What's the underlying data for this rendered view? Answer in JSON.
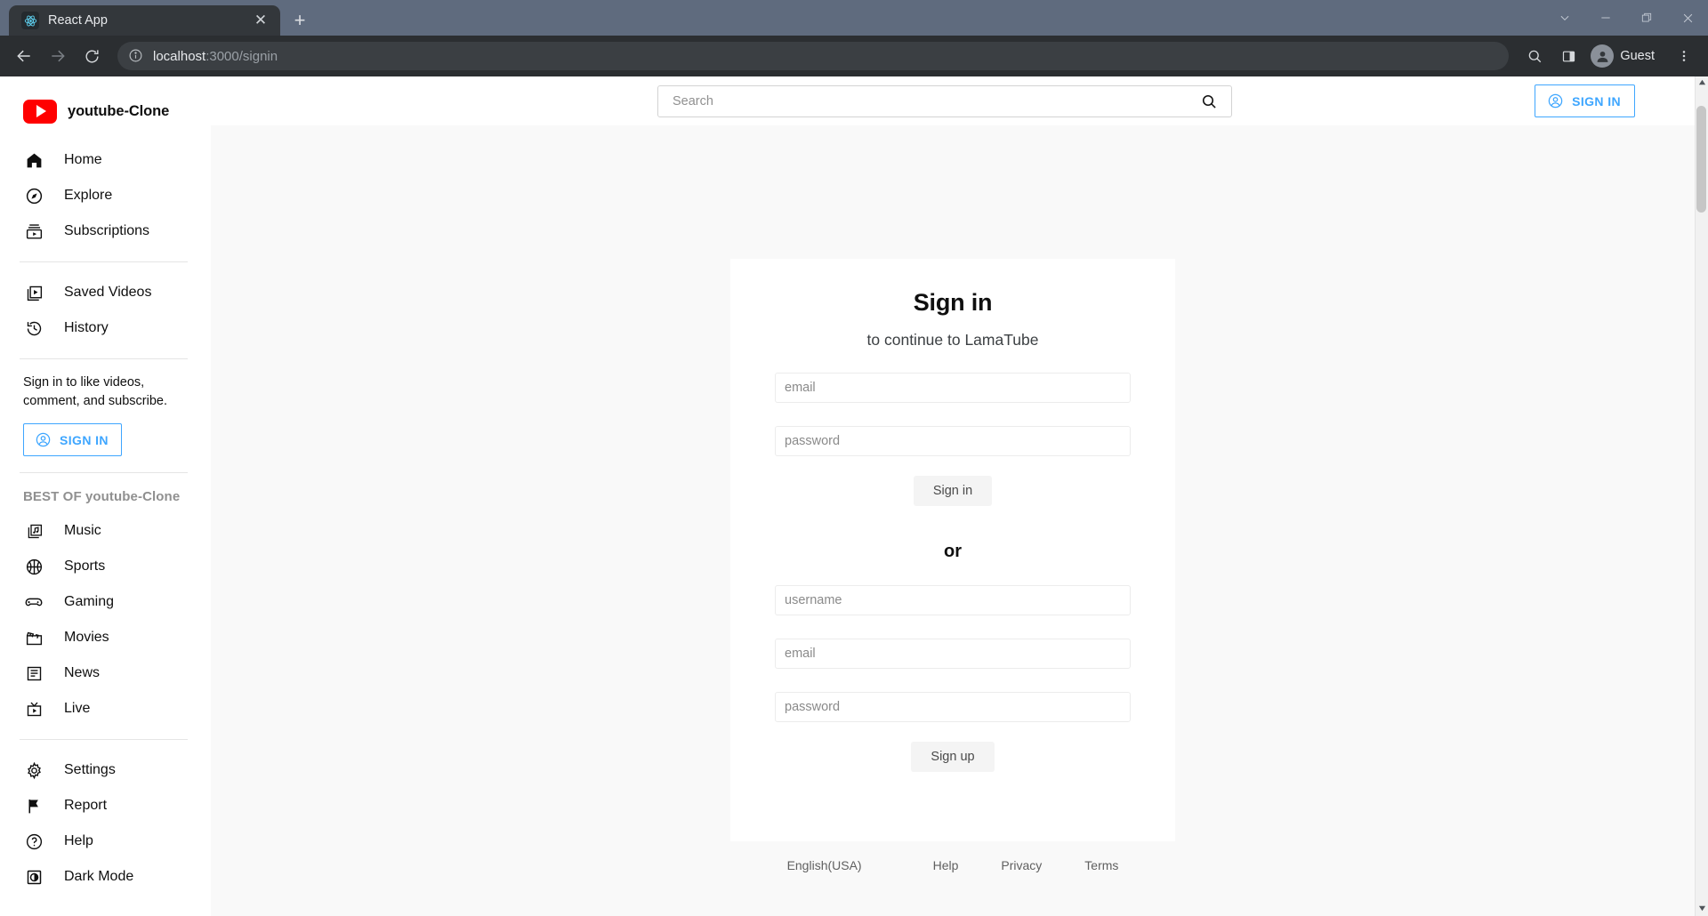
{
  "browser": {
    "tab": {
      "title": "React App",
      "favicon": "react-icon",
      "close_label": "✕"
    },
    "new_tab_label": "+",
    "window_controls": {
      "collapse": "chevron-down-icon",
      "minimize": "—",
      "restore": "restore-icon",
      "close": "✕"
    },
    "toolbar": {
      "back": "back-arrow-icon",
      "forward": "forward-arrow-icon",
      "reload": "reload-icon",
      "site_info": "info-icon",
      "url_host": "localhost",
      "url_rest": ":3000/signin",
      "search_tabs": "search-icon",
      "side_panel": "side-panel-icon",
      "profile_name": "Guest",
      "menu": "three-dot-menu-icon"
    }
  },
  "sidebar": {
    "brand": "youtube-Clone",
    "primary": [
      {
        "label": "Home",
        "icon": "home-icon"
      },
      {
        "label": "Explore",
        "icon": "compass-icon"
      },
      {
        "label": "Subscriptions",
        "icon": "subscriptions-icon"
      }
    ],
    "library": [
      {
        "label": "Saved Videos",
        "icon": "saved-videos-icon"
      },
      {
        "label": "History",
        "icon": "history-icon"
      }
    ],
    "signin_prompt": "Sign in to like videos, comment, and subscribe.",
    "signin_button": "SIGN IN",
    "section_title": "BEST OF youtube-Clone",
    "categories": [
      {
        "label": "Music",
        "icon": "music-icon"
      },
      {
        "label": "Sports",
        "icon": "sports-icon"
      },
      {
        "label": "Gaming",
        "icon": "gaming-icon"
      },
      {
        "label": "Movies",
        "icon": "movies-icon"
      },
      {
        "label": "News",
        "icon": "news-icon"
      },
      {
        "label": "Live",
        "icon": "live-icon"
      }
    ],
    "settings": [
      {
        "label": "Settings",
        "icon": "gear-icon"
      },
      {
        "label": "Report",
        "icon": "flag-icon"
      },
      {
        "label": "Help",
        "icon": "help-icon"
      },
      {
        "label": "Dark Mode",
        "icon": "dark-mode-icon"
      }
    ]
  },
  "navbar": {
    "search_placeholder": "Search",
    "search_value": "",
    "search_icon": "search-icon",
    "signin_button": "SIGN IN",
    "signin_icon": "account-circle-icon"
  },
  "signin_card": {
    "title": "Sign in",
    "subtitle": "to continue to LamaTube",
    "email_placeholder": "email",
    "password_placeholder": "password",
    "submit_label": "Sign in",
    "separator": "or",
    "username_placeholder": "username",
    "signup_email_placeholder": "email",
    "signup_password_placeholder": "password",
    "signup_label": "Sign up"
  },
  "footer": {
    "language": "English(USA)",
    "links": [
      "Help",
      "Privacy",
      "Terms"
    ]
  },
  "colors": {
    "accent_blue": "#3ea6ff",
    "brand_red": "#ff0000",
    "page_bg": "#f9f9f9"
  }
}
